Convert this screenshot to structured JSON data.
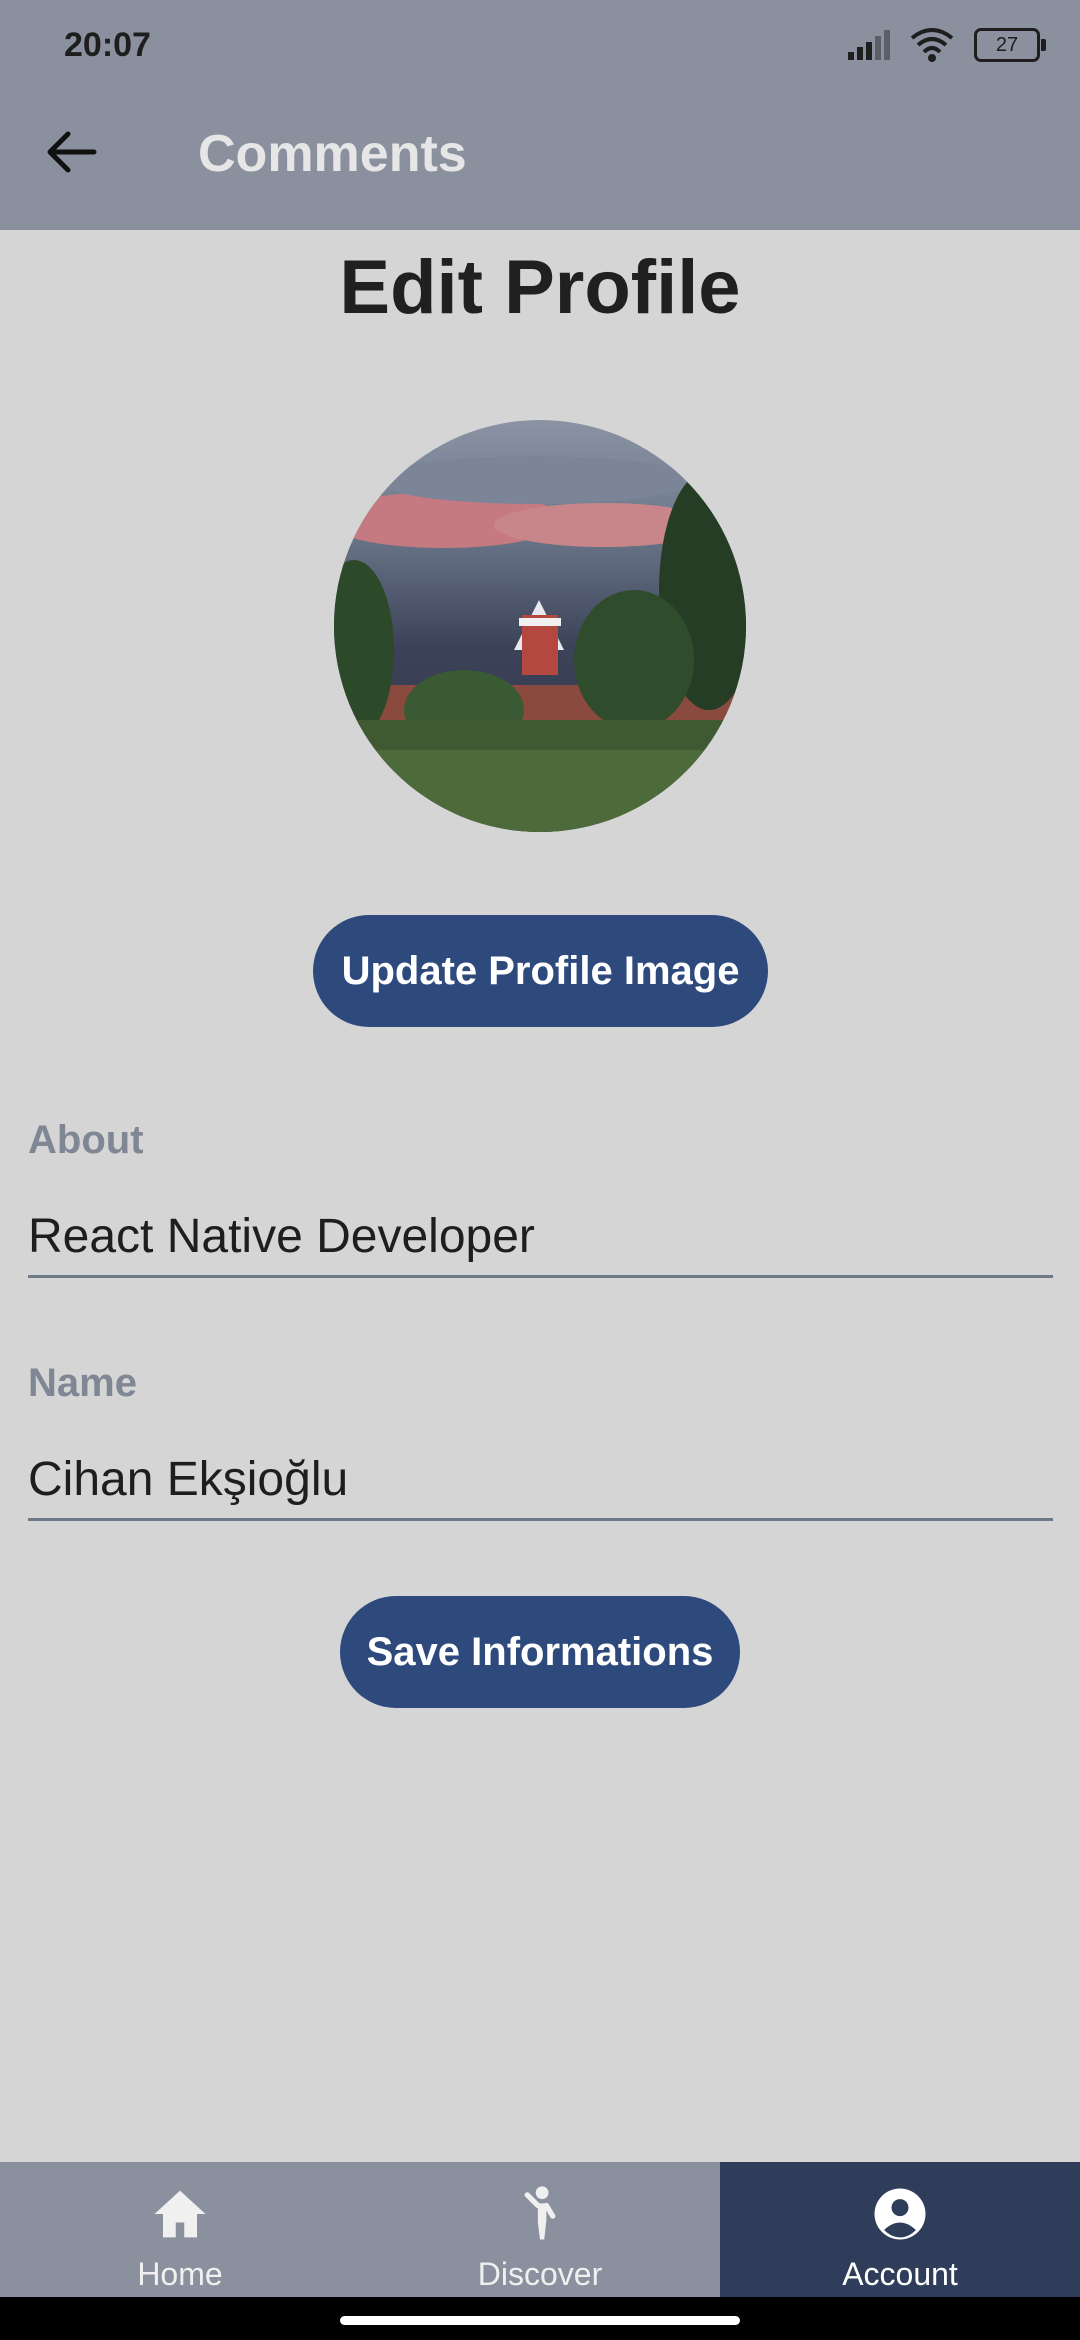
{
  "status_bar": {
    "time": "20:07",
    "battery": "27"
  },
  "app_bar": {
    "title": "Comments"
  },
  "page": {
    "title": "Edit Profile"
  },
  "buttons": {
    "update_image": "Update Profile Image",
    "save": "Save Informations"
  },
  "fields": {
    "about": {
      "label": "About",
      "value": "React Native Developer"
    },
    "name": {
      "label": "Name",
      "value": "Cihan Ekşioğlu"
    }
  },
  "bottom_nav": {
    "items": [
      {
        "label": "Home",
        "icon": "home-icon"
      },
      {
        "label": "Discover",
        "icon": "person-waving-icon"
      },
      {
        "label": "Account",
        "icon": "account-circle-icon",
        "active": true
      }
    ]
  },
  "colors": {
    "app_bar": "#8a909d",
    "background": "#d5d5d5",
    "button": "#2e4a7d",
    "nav_active": "#2f3d5a",
    "label": "#7f8795"
  }
}
